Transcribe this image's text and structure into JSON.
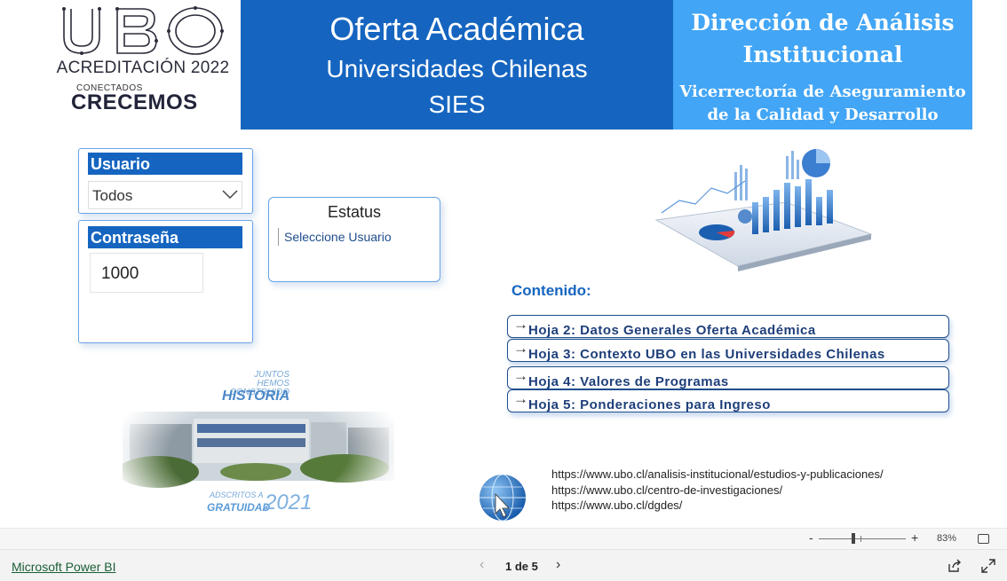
{
  "header": {
    "logo": {
      "letters": "UBO",
      "accreditation": "ACREDITACIÓN 2022",
      "tag_small": "CONECTADOS",
      "tag_big": "CRECEMOS"
    },
    "title_line1": "Oferta Académica",
    "title_line2": "Universidades Chilenas",
    "title_line3": "SIES",
    "right_line1": "Dirección de Análisis Institucional",
    "right_line2": "Vicerrectoría de Aseguramiento de la Calidad y Desarrollo"
  },
  "login": {
    "user_label": "Usuario",
    "user_value": "Todos",
    "password_label": "Contraseña",
    "password_value": "1000"
  },
  "status": {
    "title": "Estatus",
    "message": "Seleccione Usuario"
  },
  "contents": {
    "title": "Contenido:",
    "links": [
      "Hoja 2: Datos Generales Oferta Académica",
      "Hoja 3: Contexto UBO en las Universidades Chilenas",
      "Hoja 4: Valores de Programas",
      "Hoja 5: Ponderaciones para Ingreso"
    ]
  },
  "urls": [
    "https://www.ubo.cl/analisis-institucional/estudios-y-publicaciones/",
    "https://www.ubo.cl/centro-de-investigaciones/",
    "https://www.ubo.cl/dgdes/"
  ],
  "campus_banner": {
    "juntos": "JUNTOS HEMOS CONSTRUIDO",
    "historia": "HISTORIA",
    "adscritos": "ADSCRITOS A",
    "gratuidad": "GRATUIDAD",
    "year": "2021"
  },
  "zoom": {
    "minus": "-",
    "plus": "+",
    "percent": "83%"
  },
  "footer": {
    "powerbi_link": "Microsoft Power BI",
    "page_indicator": "1 de 5",
    "prev": "‹",
    "next": "›"
  },
  "colors": {
    "primary": "#1565c0",
    "light": "#42a5f5",
    "link_text": "#1f3f7a"
  }
}
